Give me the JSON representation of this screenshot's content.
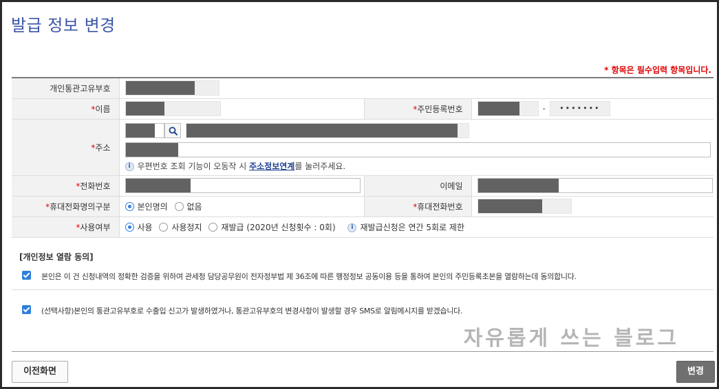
{
  "page": {
    "title": "발급 정보 변경"
  },
  "required_note": "* 항목은 필수입력 항목입니다.",
  "form": {
    "customs_code_label": "개인통관고유부호",
    "name_label": "이름",
    "rrn_label": "주민등록번호",
    "rrn_dash": "-",
    "rrn_masked": "•••••••",
    "address_label": "주소",
    "address_help_pre": "우편번호 조회 기능이 오동작 시 ",
    "address_help_link": "주소정보연계",
    "address_help_post": "를 눌러주세요.",
    "phone_label": "전화번호",
    "email_label": "이메일",
    "mobile_owner_label": "휴대전화명의구분",
    "mobile_owner_options": [
      "본인명의",
      "없음"
    ],
    "mobile_label": "휴대전화번호",
    "usage_label": "사용여부",
    "usage_options": [
      "사용",
      "사용정지",
      "재발급 (2020년 신청횟수 : 0회)"
    ],
    "usage_help": "재발급신청은 연간 5회로 제한",
    "star": "*",
    "info_glyph": "i"
  },
  "consent": {
    "heading": "[개인정보 열람 동의]",
    "item1": "본인은 이 건 신청내역의 정확한 검증을 위하여 관세청 담당공무원이 전자정부법 제 36조에 따른 행정정보 공동이용 등을 통하여 본인의 주민등록초본을 열람하는데 동의합니다.",
    "item2": "(선택사항)본인의 통관고유부호로 수출입 신고가 발생하였거나, 통관고유부호의 변경사항이 발생할 경우 SMS로 알림메시지를 받겠습니다."
  },
  "watermark": "자유롭게 쓰는 블로그",
  "buttons": {
    "prev": "이전화면",
    "apply": "변경"
  },
  "colors": {
    "title": "#3b55a8",
    "required": "#e00000",
    "accent": "#2f7fdc",
    "mask": "#626262"
  }
}
